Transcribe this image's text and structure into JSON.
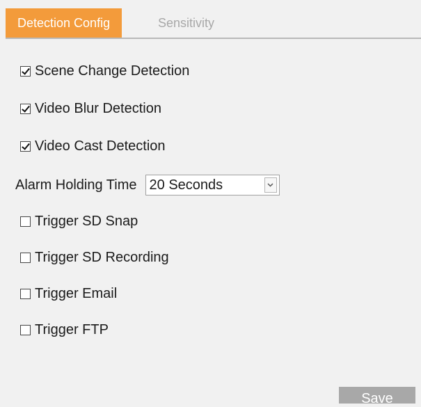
{
  "tabs": [
    {
      "label": "Detection Config",
      "active": true
    },
    {
      "label": "Sensitivity",
      "active": false
    }
  ],
  "options": [
    {
      "label": "Scene Change Detection",
      "checked": true
    },
    {
      "label": "Video Blur Detection",
      "checked": true
    },
    {
      "label": "Video Cast Detection",
      "checked": true
    }
  ],
  "alarm": {
    "label": "Alarm Holding Time",
    "value": "20 Seconds"
  },
  "triggers": [
    {
      "label": "Trigger SD Snap",
      "checked": false
    },
    {
      "label": "Trigger SD Recording",
      "checked": false
    },
    {
      "label": "Trigger Email",
      "checked": false
    },
    {
      "label": "Trigger FTP",
      "checked": false
    }
  ],
  "save_label": "Save",
  "colors": {
    "accent": "#f39b3b",
    "background": "#f1f1f1",
    "button": "#a8a8a8"
  }
}
